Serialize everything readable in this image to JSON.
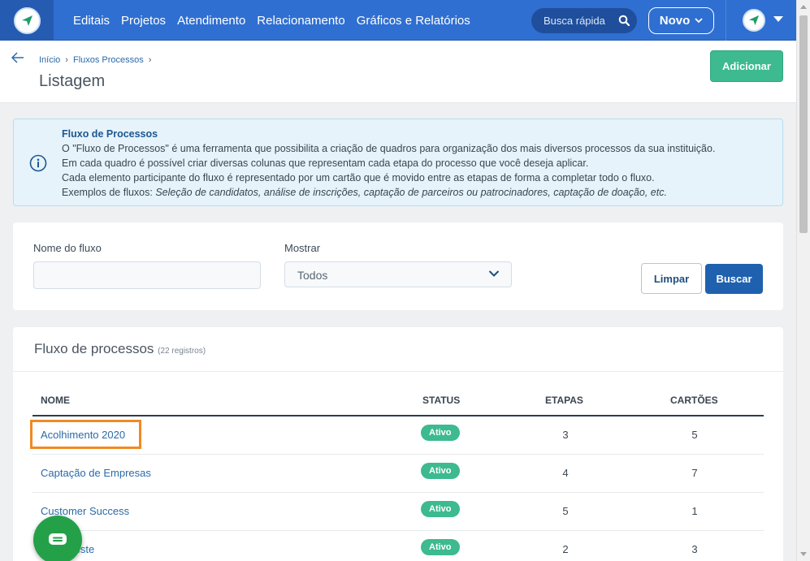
{
  "nav": {
    "items": [
      "Editais",
      "Projetos",
      "Atendimento",
      "Relacionamento",
      "Gráficos e Relatórios"
    ],
    "search_placeholder": "Busca rápida",
    "new_label": "Novo"
  },
  "breadcrumb": {
    "home": "Início",
    "current": "Fluxos Processos"
  },
  "page": {
    "title": "Listagem",
    "add_label": "Adicionar"
  },
  "info": {
    "title": "Fluxo de Processos",
    "line1": "O \"Fluxo de Processos\" é uma ferramenta que possibilita a criação de quadros para organização dos mais diversos processos da sua instituição.",
    "line2": "Em cada quadro é possível criar diversas colunas que representam cada etapa do processo que você deseja aplicar.",
    "line3": "Cada elemento participante do fluxo é representado por um cartão que é movido entre as etapas de forma a completar todo o fluxo.",
    "line4_prefix": "Exemplos de fluxos: ",
    "line4_examples": "Seleção de candidatos, análise de inscrições, captação de parceiros ou patrocinadores, captação de doação, etc."
  },
  "filters": {
    "name_label": "Nome do fluxo",
    "name_value": "",
    "show_label": "Mostrar",
    "show_value": "Todos",
    "clear_label": "Limpar",
    "search_label": "Buscar"
  },
  "list": {
    "title": "Fluxo de processos",
    "count": "(22 registros)",
    "columns": {
      "name": "NOME",
      "status": "STATUS",
      "steps": "ETAPAS",
      "cards": "CARTÕES"
    },
    "rows": [
      {
        "name": "Acolhimento 2020",
        "status": "Ativo",
        "steps": "3",
        "cards": "5"
      },
      {
        "name": "Captação de Empresas",
        "status": "Ativo",
        "steps": "4",
        "cards": "7"
      },
      {
        "name": "Customer Success",
        "status": "Ativo",
        "steps": "5",
        "cards": "1"
      },
      {
        "name": "Fluxo Teste",
        "status": "Ativo",
        "steps": "2",
        "cards": "3"
      }
    ]
  },
  "colors": {
    "nav_bg": "#2f6fd1",
    "accent_green": "#3dba8f",
    "primary": "#1f61ae",
    "highlight": "#f08a24"
  }
}
